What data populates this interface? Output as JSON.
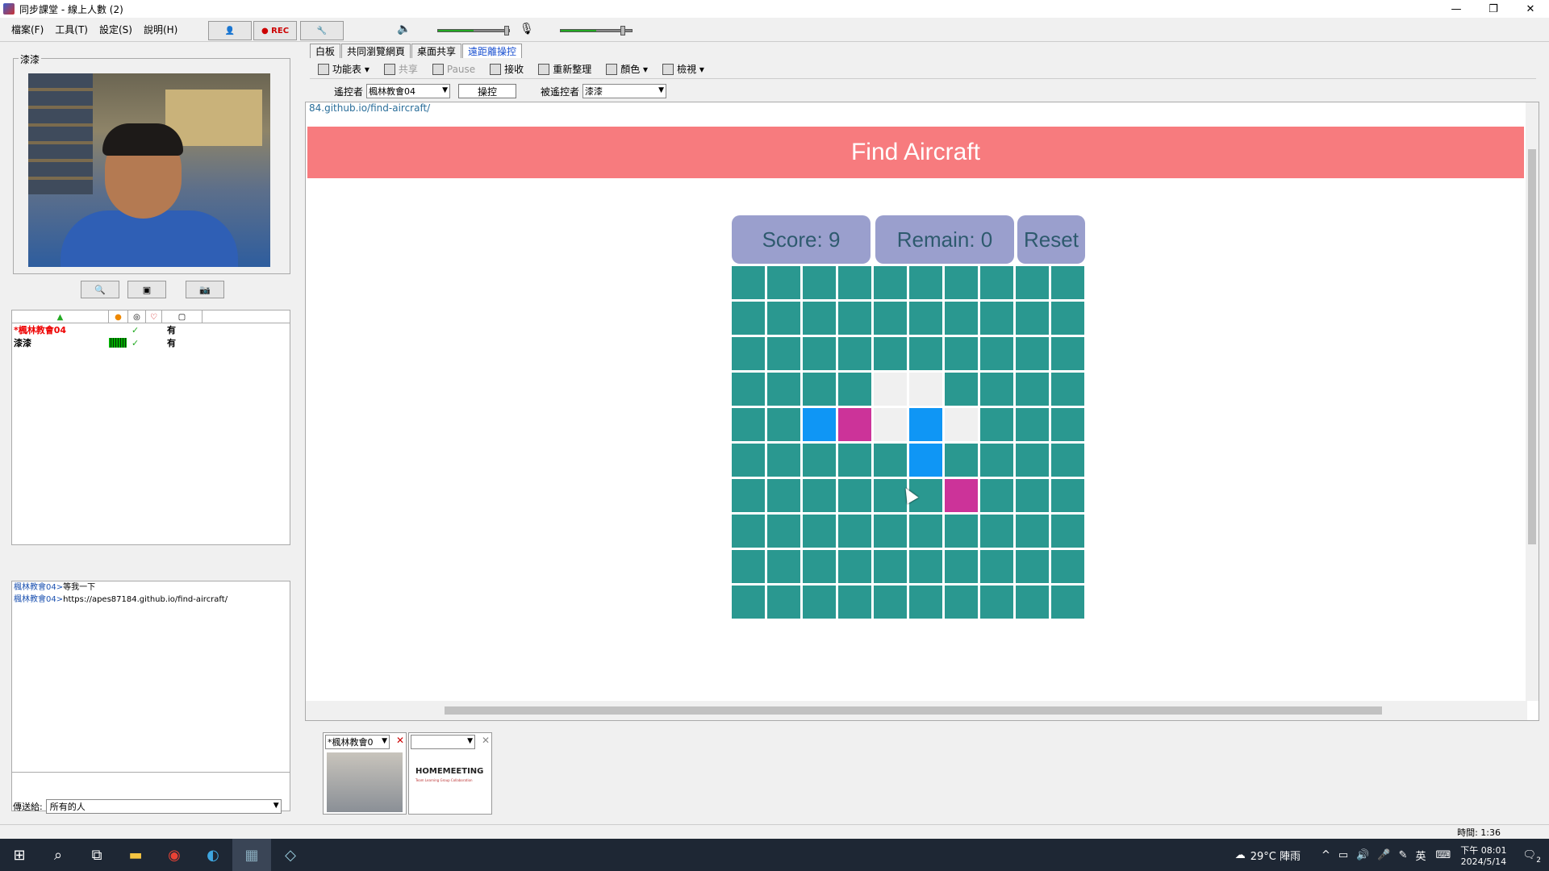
{
  "window": {
    "title": "同步課堂 - 線上人數 (2)",
    "min": "—",
    "max": "❐",
    "close": "✕"
  },
  "menu": [
    "檔案(F)",
    "工具(T)",
    "設定(S)",
    "說明(H)"
  ],
  "toolbar": {
    "rec_label": "● REC"
  },
  "left": {
    "video_label": "漆漆",
    "users_header": [
      "",
      "",
      "",
      ""
    ],
    "users": [
      {
        "name": "*楓林教會04",
        "check": "✓",
        "value": "有"
      },
      {
        "name": "漆漆",
        "check": "✓",
        "value": "有"
      }
    ],
    "chat": [
      {
        "who": "楓林教會04>",
        "text": "等我一下"
      },
      {
        "who": "楓林教會04>",
        "text": "https://apes87184.github.io/find-aircraft/"
      }
    ],
    "send_label": "傳送給:",
    "send_target": "所有的人"
  },
  "tabs": [
    "白板",
    "共同瀏覽網頁",
    "桌面共享",
    "遠距離操控"
  ],
  "toolbar2": {
    "menu": "功能表",
    "share": "共享",
    "pause": "Pause",
    "receive": "接收",
    "refresh": "重新整理",
    "color": "顏色",
    "view": "檢視"
  },
  "control": {
    "controller_label": "遙控者",
    "controller_value": "楓林教會04",
    "operate_button": "操控",
    "controlled_label": "被遙控者",
    "controlled_value": "漆漆"
  },
  "browser": {
    "url": "84.github.io/find-aircraft/",
    "page_title": "Find Aircraft",
    "score": "Score: 9",
    "remain": "Remain: 0",
    "reset": "Reset",
    "colors": {
      "water": "#2a9890",
      "empty": "#f0f0f0",
      "blue": "#0f96f5",
      "magenta": "#cc3399"
    },
    "grid": [
      "wwwwwwwwww",
      "wwwwwwwwww",
      "wwwwwwwwww",
      "wwwweewwww",
      "wwbmebewww",
      "wwwwwbwwww",
      "wwwwwwmwww",
      "wwwwwwwwww",
      "wwwwwwwwww",
      "wwwwwwwwww"
    ]
  },
  "bottom": {
    "card1_name": "*楓林教會0",
    "card2_logo": "HOMEMEETING",
    "card2_sub": "Team Learning Group Collaboration"
  },
  "status": {
    "time": "時間: 1:36"
  },
  "taskbar": {
    "weather": "29°C 陣雨",
    "ime": "英",
    "clock_time": "下午 08:01",
    "clock_date": "2024/5/14",
    "notif": "2"
  }
}
